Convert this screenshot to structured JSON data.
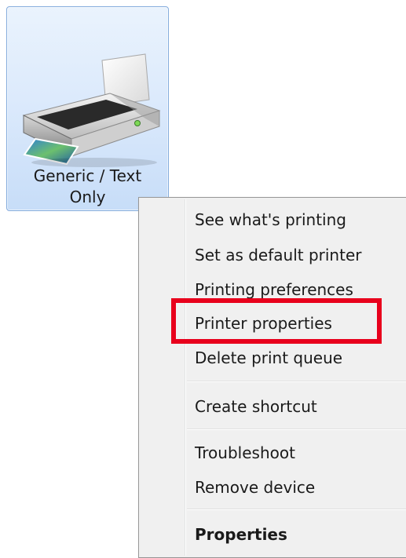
{
  "printer": {
    "name_line1": "Generic / Text",
    "name_line2": "Only",
    "icon": "printer-icon"
  },
  "context_menu": {
    "items": [
      {
        "label": "See what's printing"
      },
      {
        "label": "Set as default printer"
      },
      {
        "label": "Printing preferences"
      },
      {
        "label": "Printer properties",
        "highlighted": true
      },
      {
        "label": "Delete print queue"
      },
      {
        "label": "Create shortcut"
      },
      {
        "label": "Troubleshoot"
      },
      {
        "label": "Remove device"
      },
      {
        "label": "Properties",
        "bold": true
      }
    ]
  },
  "colors": {
    "highlight_border": "#e8001c",
    "tile_border": "#84acdd",
    "menu_background": "#f0f0f0"
  }
}
